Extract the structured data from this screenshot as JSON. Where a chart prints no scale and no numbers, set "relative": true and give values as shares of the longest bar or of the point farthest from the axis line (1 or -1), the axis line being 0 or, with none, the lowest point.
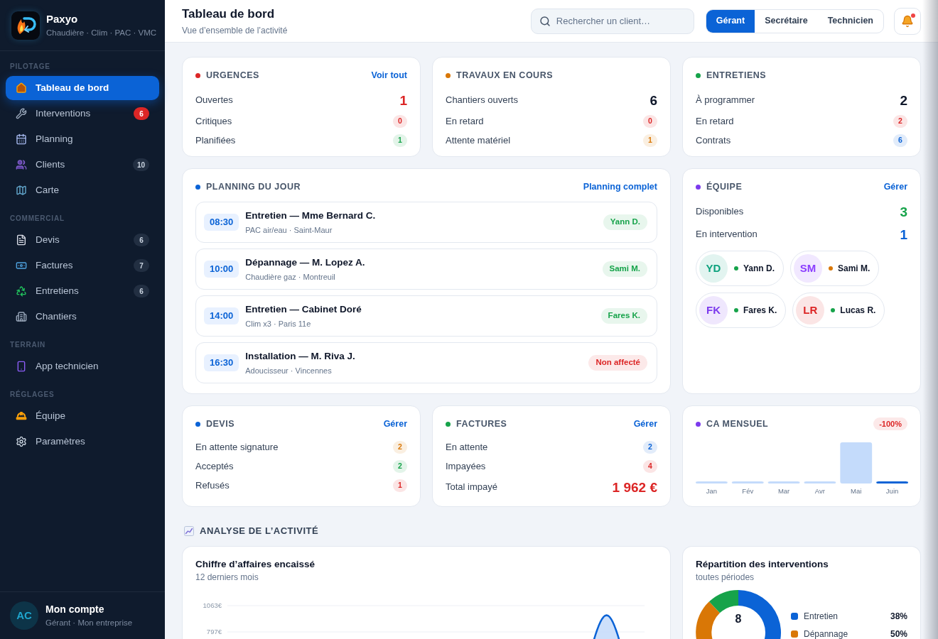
{
  "sidebar": {
    "brand": {
      "name": "Paxyo",
      "tagline": "Chaudière · Clim · PAC · VMC"
    },
    "sections": [
      {
        "title": "PILOTAGE",
        "items": [
          {
            "label": "Tableau de bord",
            "selected": true
          },
          {
            "label": "Interventions",
            "selected": false,
            "badge": {
              "text": "6",
              "alert": true
            }
          },
          {
            "label": "Planning",
            "selected": false
          },
          {
            "label": "Clients",
            "selected": false,
            "badge": {
              "text": "10",
              "alert": false
            }
          },
          {
            "label": "Carte",
            "selected": false
          }
        ]
      },
      {
        "title": "COMMERCIAL",
        "items": [
          {
            "label": "Devis",
            "selected": false,
            "badge": {
              "text": "6",
              "alert": false
            }
          },
          {
            "label": "Factures",
            "selected": false,
            "badge": {
              "text": "7",
              "alert": false
            }
          },
          {
            "label": "Entretiens",
            "selected": false,
            "badge": {
              "text": "6",
              "alert": false
            }
          },
          {
            "label": "Chantiers",
            "selected": false
          }
        ]
      },
      {
        "title": "TERRAIN",
        "items": [
          {
            "label": "App technicien",
            "selected": false
          }
        ]
      },
      {
        "title": "RÉGLAGES",
        "items": [
          {
            "label": "Équipe",
            "selected": false
          },
          {
            "label": "Paramètres",
            "selected": false
          }
        ]
      }
    ],
    "account": {
      "initials": "AC",
      "name": "Mon compte",
      "role": "Gérant · Mon entreprise"
    }
  },
  "header": {
    "title": "Tableau de bord",
    "subtitle": "Vue d’ensemble de l’activité",
    "search": {
      "placeholder": "Rechercher un client…"
    },
    "roles": [
      {
        "label": "Gérant",
        "selected": true
      },
      {
        "label": "Secrétaire",
        "selected": false
      },
      {
        "label": "Technicien",
        "selected": false
      }
    ],
    "notifications": {
      "unread": true
    }
  },
  "overview_cards": [
    {
      "title": "URGENCES",
      "color": "#dc2626",
      "link": "Voir tout",
      "rows": [
        {
          "label": "Ouvertes",
          "value": "1",
          "kind": "figure",
          "color": "#dc2626"
        },
        {
          "label": "Critiques",
          "value": "0",
          "kind": "pill",
          "color": "#dc2626"
        },
        {
          "label": "Planifiées",
          "value": "1",
          "kind": "pill",
          "color": "#16a34a"
        }
      ]
    },
    {
      "title": "TRAVAUX EN COURS",
      "color": "#d97706",
      "rows": [
        {
          "label": "Chantiers ouverts",
          "value": "6",
          "kind": "figure",
          "color": "#0f172a"
        },
        {
          "label": "En retard",
          "value": "0",
          "kind": "pill",
          "color": "#dc2626"
        },
        {
          "label": "Attente matériel",
          "value": "1",
          "kind": "pill",
          "color": "#d97706"
        }
      ]
    },
    {
      "title": "ENTRETIENS",
      "color": "#16a34a",
      "rows": [
        {
          "label": "À programmer",
          "value": "2",
          "kind": "figure",
          "color": "#0f172a"
        },
        {
          "label": "En retard",
          "value": "2",
          "kind": "pill",
          "color": "#dc2626"
        },
        {
          "label": "Contrats",
          "value": "6",
          "kind": "pill",
          "color": "#0b63d6"
        }
      ]
    }
  ],
  "planning": {
    "title": "PLANNING DU JOUR",
    "color": "#0b63d6",
    "link": "Planning complet",
    "items": [
      {
        "time": "08:30",
        "title": "Entretien — Mme Bernard C.",
        "details": "PAC air/eau · Saint-Maur",
        "assignee": "Yann D.",
        "assigned": true
      },
      {
        "time": "10:00",
        "title": "Dépannage — M. Lopez A.",
        "details": "Chaudière gaz · Montreuil",
        "assignee": "Sami M.",
        "assigned": true
      },
      {
        "time": "14:00",
        "title": "Entretien — Cabinet Doré",
        "details": "Clim x3 · Paris 11e",
        "assignee": "Fares K.",
        "assigned": true
      },
      {
        "time": "16:30",
        "title": "Installation — M. Riva J.",
        "details": "Adoucisseur · Vincennes",
        "assignee": "Non affecté",
        "assigned": false
      }
    ]
  },
  "team": {
    "title": "ÉQUIPE",
    "color": "#7c3aed",
    "link": "Gérer",
    "stats": [
      {
        "label": "Disponibles",
        "value": "3",
        "kind": "figure",
        "color": "#16a34a"
      },
      {
        "label": "En intervention",
        "value": "1",
        "kind": "figure",
        "color": "#0b63d6"
      }
    ],
    "members": [
      {
        "initials": "YD",
        "name": "Yann D.",
        "color": "#10a37f",
        "busy": false
      },
      {
        "initials": "SM",
        "name": "Sami M.",
        "color": "#8b3dff",
        "busy": true
      },
      {
        "initials": "FK",
        "name": "Fares K.",
        "color": "#7c3aed",
        "busy": false
      },
      {
        "initials": "LR",
        "name": "Lucas R.",
        "color": "#dc2626",
        "busy": false
      }
    ]
  },
  "finance_cards": [
    {
      "title": "DEVIS",
      "color": "#0b63d6",
      "link": "Gérer",
      "rows": [
        {
          "label": "En attente signature",
          "value": "2",
          "kind": "pill",
          "color": "#d97706"
        },
        {
          "label": "Acceptés",
          "value": "2",
          "kind": "pill",
          "color": "#16a34a"
        },
        {
          "label": "Refusés",
          "value": "1",
          "kind": "pill",
          "color": "#dc2626"
        }
      ]
    },
    {
      "title": "FACTURES",
      "color": "#16a34a",
      "link": "Gérer",
      "rows": [
        {
          "label": "En attente",
          "value": "2",
          "kind": "pill",
          "color": "#0b63d6"
        },
        {
          "label": "Impayées",
          "value": "4",
          "kind": "pill",
          "color": "#dc2626"
        },
        {
          "label": "Total impayé",
          "value": "1 962 €",
          "kind": "figure",
          "color": "#dc2626"
        }
      ]
    }
  ],
  "monthly_revenue": {
    "title": "CA MENSUEL",
    "color": "#7c3aed",
    "change": {
      "text": "-100%",
      "negative": true
    },
    "chart_data": {
      "type": "bar",
      "relative": true,
      "categories": [
        "Jan",
        "Fév",
        "Mar",
        "Avr",
        "Mai",
        "Juin"
      ],
      "values": [
        0,
        0,
        0,
        0,
        1,
        0
      ]
    }
  },
  "analysis": {
    "title": "ANALYSE DE L’ACTIVITÉ",
    "revenue": {
      "title": "Chiffre d’affaires encaissé",
      "subtitle": "12 derniers mois",
      "axis_labels": [
        "1063€",
        "797€"
      ]
    },
    "breakdown": {
      "title": "Répartition des interventions",
      "subtitle": "toutes périodes",
      "total": "8",
      "chart_data": {
        "type": "donut",
        "values": [
          38,
          50,
          12
        ],
        "colors": [
          "#0b63d6",
          "#d97706",
          "#16a34a"
        ]
      },
      "legend": [
        {
          "label": "Entretien",
          "share": "38%",
          "color": "#0b63d6"
        },
        {
          "label": "Dépannage",
          "share": "50%",
          "color": "#d97706"
        }
      ]
    }
  }
}
